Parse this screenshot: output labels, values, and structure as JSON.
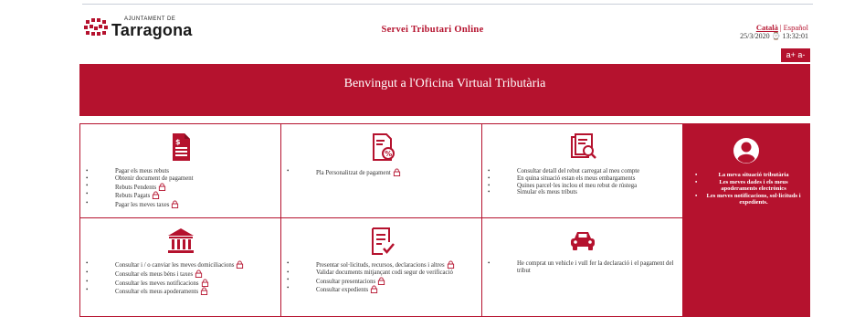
{
  "header": {
    "logo_small": "AJUNTAMENT DE",
    "logo_big": "Tarragona",
    "service_title": "Servei Tributari Online",
    "lang_ca": "Català",
    "lang_es": "Español",
    "date": "25/3/2020",
    "time": "13:32:01",
    "zoom_label": "a+ a-"
  },
  "banner": {
    "title": "Benvingut a l'Oficina Virtual Tributària"
  },
  "colors": {
    "brand": "#b5122e",
    "border": "#b5122e",
    "text": "#333333"
  },
  "cards": [
    {
      "icon": "receipt-dollar-icon",
      "items": [
        {
          "label": "Pagar els meus rebuts",
          "locked": false
        },
        {
          "label": "Obtenir document de pagament",
          "locked": false
        },
        {
          "label": "Rebuts Pendents",
          "locked": true
        },
        {
          "label": "Rebuts Pagats",
          "locked": true
        },
        {
          "label": "Pagar les meves taxes",
          "locked": true
        }
      ]
    },
    {
      "icon": "percent-document-icon",
      "items": [
        {
          "label": "Pla Personalitzat de pagament",
          "locked": true
        }
      ]
    },
    {
      "icon": "search-document-icon",
      "items": [
        {
          "label": "Consultar detall del rebut carregat al meu compte",
          "locked": false
        },
        {
          "label": "En quina situació estan els meus embargaments",
          "locked": false
        },
        {
          "label": "Quines parcel·les inclou el meu rebut de rústega",
          "locked": false
        },
        {
          "label": "Simular els meus tributs",
          "locked": false
        }
      ]
    },
    {
      "icon": "bank-building-icon",
      "items": [
        {
          "label": "Consultar i / o canviar les meves domiciliacions",
          "locked": true
        },
        {
          "label": "Consultar els meus béns i taxes",
          "locked": true
        },
        {
          "label": "Consultar les meves notificacions",
          "locked": true
        },
        {
          "label": "Consultar els meus apoderaments",
          "locked": true
        }
      ]
    },
    {
      "icon": "checklist-document-icon",
      "items": [
        {
          "label": "Presentar sol·licituds, recursos, declaracions i altres",
          "locked": true
        },
        {
          "label": "Validar documents mitjançant codi segur de verificació",
          "locked": false
        },
        {
          "label": "Consultar presentacions",
          "locked": true
        },
        {
          "label": "Consultar expedients",
          "locked": true
        }
      ]
    },
    {
      "icon": "car-icon",
      "items": [
        {
          "label": "He comprat un vehicle i vull fer la declaració i el pagament del tribut",
          "locked": false
        }
      ]
    }
  ],
  "side_panel": {
    "icon": "user-circle-icon",
    "items": [
      "La meva situació tributària",
      "Les meves dades i els meus apoderaments electrònics",
      "Les meves notificacions, sol·licituds i expedients."
    ]
  }
}
